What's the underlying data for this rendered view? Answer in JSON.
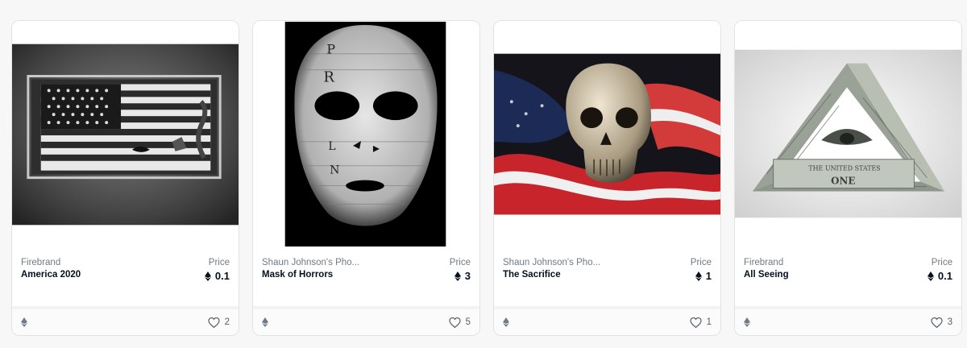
{
  "cards": [
    {
      "collection": "Firebrand",
      "title": "America 2020",
      "price_label": "Price",
      "price": "0.1",
      "favorites": "2",
      "currency_icon": "ethereum-icon",
      "favorite_icon": "heart-icon"
    },
    {
      "collection": "Shaun Johnson's Pho...",
      "title": "Mask of Horrors",
      "price_label": "Price",
      "price": "3",
      "favorites": "5",
      "currency_icon": "ethereum-icon",
      "favorite_icon": "heart-icon"
    },
    {
      "collection": "Shaun Johnson's Pho...",
      "title": "The Sacrifice",
      "price_label": "Price",
      "price": "1",
      "favorites": "1",
      "currency_icon": "ethereum-icon",
      "favorite_icon": "heart-icon"
    },
    {
      "collection": "Firebrand",
      "title": "All Seeing",
      "price_label": "Price",
      "price": "0.1",
      "favorites": "3",
      "currency_icon": "ethereum-icon",
      "favorite_icon": "heart-icon"
    }
  ],
  "colors": {
    "card_bg": "#ffffff",
    "muted_text": "#707a83",
    "title_text": "#04111d",
    "border": "#e2e2e2"
  }
}
